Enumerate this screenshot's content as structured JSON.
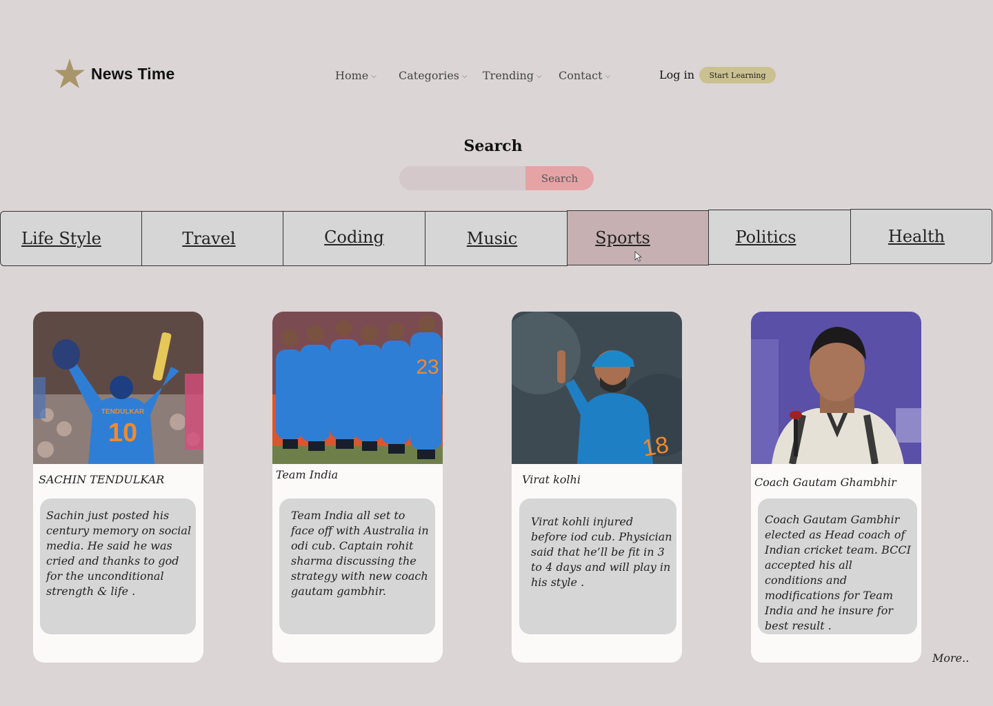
{
  "brand": {
    "name": "News Time",
    "icon": "star-icon",
    "icon_color": "#a8966a"
  },
  "nav": {
    "home": "Home",
    "categories": "Categories",
    "trending": "Trending",
    "contact": "Contact",
    "chevron": "⌵"
  },
  "header": {
    "login": "Log in",
    "start": "Start Learning"
  },
  "search": {
    "title": "Search",
    "placeholder": "",
    "value": "",
    "button": "Search"
  },
  "tabs": [
    {
      "label": "Life Style",
      "active": false
    },
    {
      "label": "Travel",
      "active": false
    },
    {
      "label": "Coding",
      "active": false
    },
    {
      "label": "Music",
      "active": false
    },
    {
      "label": "Sports",
      "active": true
    },
    {
      "label": "Politics",
      "active": false
    },
    {
      "label": "Health",
      "active": false
    }
  ],
  "cards": [
    {
      "title": "SACHIN TENDULKAR",
      "body": "Sachin just posted his century memory on social media. He said he was cried and thanks to god for the unconditional strength & life .",
      "jersey_text": "TENDULKAR",
      "jersey_number": "10"
    },
    {
      "title": "Team India",
      "body": "Team India all set to face off  with Australia in odi cub. Captain rohit sharma discussing the strategy with new coach gautam gambhir.",
      "jersey_number": "23"
    },
    {
      "title": "Virat kolhi",
      "body": "Virat kohli injured before iod cub. Physician said that he’ll be fit in 3 to 4 days and will play in his style ."
    },
    {
      "title": "Coach Gautam Ghambhir",
      "body": "Coach Gautam Gambhir elected as Head coach of Indian cricket team. BCCI accepted his all conditions and modifications for Team India and he insure for best result ."
    }
  ],
  "more": "More..",
  "colors": {
    "background": "#dbd5d6",
    "active_tab": "#c6b0b1",
    "search_button": "#e5a3a6",
    "start_button": "#cbc190",
    "card": "#fcf9f9",
    "card_body": "#d6d6d6"
  }
}
